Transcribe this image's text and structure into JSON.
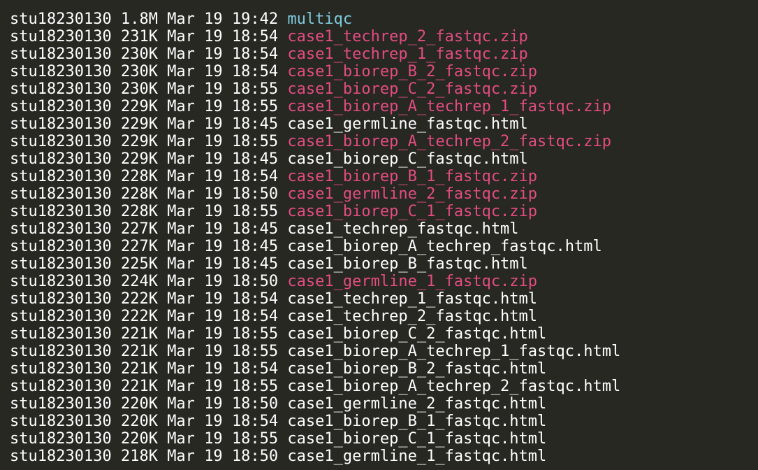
{
  "colors": {
    "background": "#272822",
    "text": "#ffffff",
    "directory": "#7ecbdd",
    "archive": "#e34c82"
  },
  "listing": [
    {
      "owner": "stu18230130",
      "size": "1.8M",
      "month": "Mar",
      "day": "19",
      "time": "19:42",
      "name": "multiqc",
      "type": "dir"
    },
    {
      "owner": "stu18230130",
      "size": "231K",
      "month": "Mar",
      "day": "19",
      "time": "18:54",
      "name": "case1_techrep_2_fastqc.zip",
      "type": "zip"
    },
    {
      "owner": "stu18230130",
      "size": "230K",
      "month": "Mar",
      "day": "19",
      "time": "18:54",
      "name": "case1_techrep_1_fastqc.zip",
      "type": "zip"
    },
    {
      "owner": "stu18230130",
      "size": "230K",
      "month": "Mar",
      "day": "19",
      "time": "18:54",
      "name": "case1_biorep_B_2_fastqc.zip",
      "type": "zip"
    },
    {
      "owner": "stu18230130",
      "size": "230K",
      "month": "Mar",
      "day": "19",
      "time": "18:55",
      "name": "case1_biorep_C_2_fastqc.zip",
      "type": "zip"
    },
    {
      "owner": "stu18230130",
      "size": "229K",
      "month": "Mar",
      "day": "19",
      "time": "18:55",
      "name": "case1_biorep_A_techrep_1_fastqc.zip",
      "type": "zip"
    },
    {
      "owner": "stu18230130",
      "size": "229K",
      "month": "Mar",
      "day": "19",
      "time": "18:45",
      "name": "case1_germline_fastqc.html",
      "type": "html"
    },
    {
      "owner": "stu18230130",
      "size": "229K",
      "month": "Mar",
      "day": "19",
      "time": "18:55",
      "name": "case1_biorep_A_techrep_2_fastqc.zip",
      "type": "zip"
    },
    {
      "owner": "stu18230130",
      "size": "229K",
      "month": "Mar",
      "day": "19",
      "time": "18:45",
      "name": "case1_biorep_C_fastqc.html",
      "type": "html"
    },
    {
      "owner": "stu18230130",
      "size": "228K",
      "month": "Mar",
      "day": "19",
      "time": "18:54",
      "name": "case1_biorep_B_1_fastqc.zip",
      "type": "zip"
    },
    {
      "owner": "stu18230130",
      "size": "228K",
      "month": "Mar",
      "day": "19",
      "time": "18:50",
      "name": "case1_germline_2_fastqc.zip",
      "type": "zip"
    },
    {
      "owner": "stu18230130",
      "size": "228K",
      "month": "Mar",
      "day": "19",
      "time": "18:55",
      "name": "case1_biorep_C_1_fastqc.zip",
      "type": "zip"
    },
    {
      "owner": "stu18230130",
      "size": "227K",
      "month": "Mar",
      "day": "19",
      "time": "18:45",
      "name": "case1_techrep_fastqc.html",
      "type": "html"
    },
    {
      "owner": "stu18230130",
      "size": "227K",
      "month": "Mar",
      "day": "19",
      "time": "18:45",
      "name": "case1_biorep_A_techrep_fastqc.html",
      "type": "html"
    },
    {
      "owner": "stu18230130",
      "size": "225K",
      "month": "Mar",
      "day": "19",
      "time": "18:45",
      "name": "case1_biorep_B_fastqc.html",
      "type": "html"
    },
    {
      "owner": "stu18230130",
      "size": "224K",
      "month": "Mar",
      "day": "19",
      "time": "18:50",
      "name": "case1_germline_1_fastqc.zip",
      "type": "zip"
    },
    {
      "owner": "stu18230130",
      "size": "222K",
      "month": "Mar",
      "day": "19",
      "time": "18:54",
      "name": "case1_techrep_1_fastqc.html",
      "type": "html"
    },
    {
      "owner": "stu18230130",
      "size": "222K",
      "month": "Mar",
      "day": "19",
      "time": "18:54",
      "name": "case1_techrep_2_fastqc.html",
      "type": "html"
    },
    {
      "owner": "stu18230130",
      "size": "221K",
      "month": "Mar",
      "day": "19",
      "time": "18:55",
      "name": "case1_biorep_C_2_fastqc.html",
      "type": "html"
    },
    {
      "owner": "stu18230130",
      "size": "221K",
      "month": "Mar",
      "day": "19",
      "time": "18:55",
      "name": "case1_biorep_A_techrep_1_fastqc.html",
      "type": "html"
    },
    {
      "owner": "stu18230130",
      "size": "221K",
      "month": "Mar",
      "day": "19",
      "time": "18:54",
      "name": "case1_biorep_B_2_fastqc.html",
      "type": "html"
    },
    {
      "owner": "stu18230130",
      "size": "221K",
      "month": "Mar",
      "day": "19",
      "time": "18:55",
      "name": "case1_biorep_A_techrep_2_fastqc.html",
      "type": "html"
    },
    {
      "owner": "stu18230130",
      "size": "220K",
      "month": "Mar",
      "day": "19",
      "time": "18:50",
      "name": "case1_germline_2_fastqc.html",
      "type": "html"
    },
    {
      "owner": "stu18230130",
      "size": "220K",
      "month": "Mar",
      "day": "19",
      "time": "18:54",
      "name": "case1_biorep_B_1_fastqc.html",
      "type": "html"
    },
    {
      "owner": "stu18230130",
      "size": "220K",
      "month": "Mar",
      "day": "19",
      "time": "18:55",
      "name": "case1_biorep_C_1_fastqc.html",
      "type": "html"
    },
    {
      "owner": "stu18230130",
      "size": "218K",
      "month": "Mar",
      "day": "19",
      "time": "18:50",
      "name": "case1_germline_1_fastqc.html",
      "type": "html"
    }
  ]
}
